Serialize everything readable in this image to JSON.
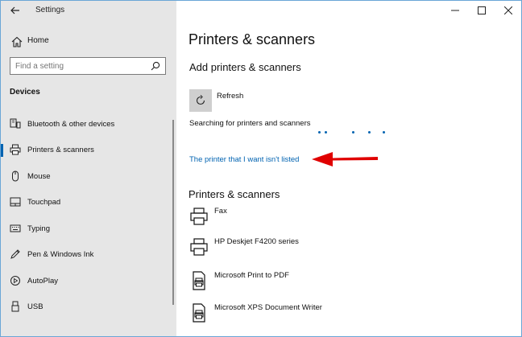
{
  "window": {
    "title": "Settings"
  },
  "sidebar": {
    "home_label": "Home",
    "search_placeholder": "Find a setting",
    "section": "Devices",
    "items": [
      {
        "label": "Bluetooth & other devices",
        "icon": "bluetooth-devices-icon"
      },
      {
        "label": "Printers & scanners",
        "icon": "printer-icon",
        "selected": true
      },
      {
        "label": "Mouse",
        "icon": "mouse-icon"
      },
      {
        "label": "Touchpad",
        "icon": "touchpad-icon"
      },
      {
        "label": "Typing",
        "icon": "keyboard-icon"
      },
      {
        "label": "Pen & Windows Ink",
        "icon": "pen-icon"
      },
      {
        "label": "AutoPlay",
        "icon": "autoplay-icon"
      },
      {
        "label": "USB",
        "icon": "usb-icon"
      }
    ]
  },
  "main": {
    "page_title": "Printers & scanners",
    "add_title": "Add printers & scanners",
    "refresh_label": "Refresh",
    "searching_text": "Searching for printers and scanners",
    "not_listed_link": "The printer that I want isn't listed",
    "printers_title": "Printers & scanners",
    "printers": [
      {
        "name": "Fax",
        "icon": "printer-icon"
      },
      {
        "name": "HP Deskjet F4200 series",
        "icon": "printer-icon"
      },
      {
        "name": "Microsoft Print to PDF",
        "icon": "document-printer-icon"
      },
      {
        "name": "Microsoft XPS Document Writer",
        "icon": "document-printer-icon"
      }
    ]
  },
  "colors": {
    "accent": "#0063b1",
    "arrow": "#e00000",
    "sidebar_bg": "#e6e6e6"
  }
}
